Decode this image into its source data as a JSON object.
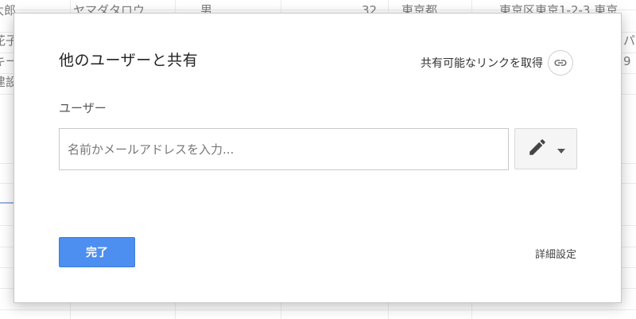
{
  "background_sheet": {
    "rows": [
      {
        "c1": "太郎",
        "c2": "ヤマダタロウ",
        "c3": "男",
        "c4": "32",
        "c5": "東京都",
        "c6": "東京区東京1-2-3 東京"
      },
      {
        "c1": "花子",
        "c6": "パ"
      },
      {
        "c1": "キー",
        "c6": "9"
      },
      {
        "c1": "建設"
      }
    ]
  },
  "dialog": {
    "title": "他のユーザーと共有",
    "share_link_label": "共有可能なリンクを取得",
    "users_label": "ユーザー",
    "user_input": {
      "placeholder": "名前かメールアドレスを入力...",
      "value": ""
    },
    "done_label": "完了",
    "advanced_label": "詳細設定"
  },
  "icons": {
    "link": "link-icon",
    "pencil": "pencil-icon",
    "caret": "caret-down-icon"
  },
  "colors": {
    "primary_button": "#4d8ff0",
    "primary_button_text": "#ffffff"
  }
}
